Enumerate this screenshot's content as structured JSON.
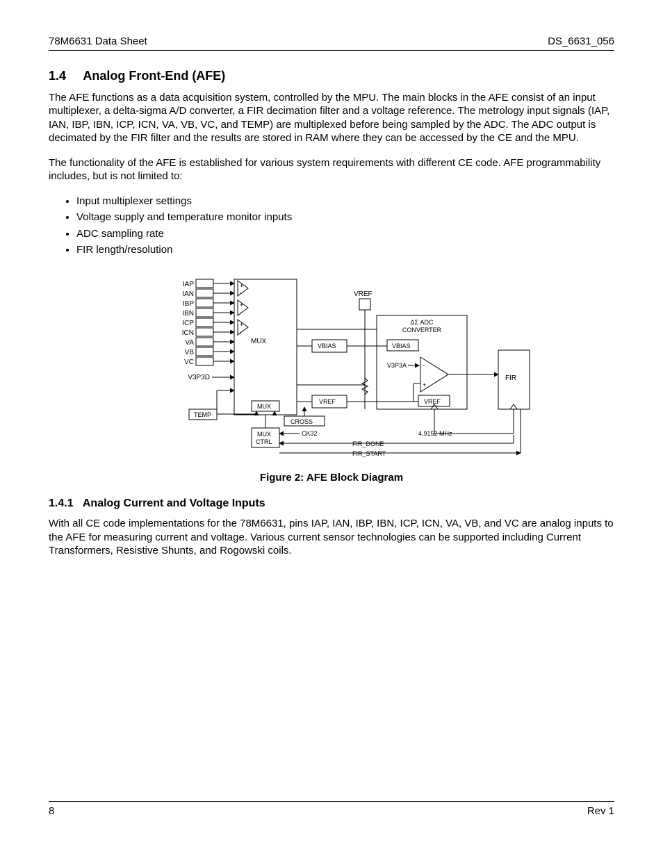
{
  "header": {
    "left": "78M6631 Data Sheet",
    "right": "DS_6631_056"
  },
  "section": {
    "num": "1.4",
    "title": "Analog Front-End (AFE)"
  },
  "para1": "The AFE functions as a data acquisition system, controlled by the MPU. The main blocks in the AFE consist of an input multiplexer, a delta-sigma A/D converter, a FIR decimation filter and a voltage reference. The metrology input signals (IAP, IAN, IBP, IBN, ICP, ICN, VA, VB, VC, and TEMP) are multiplexed before being sampled by the ADC. The ADC output is decimated by the FIR filter and the results are stored in RAM where they can be accessed by the CE and the MPU.",
  "para2": "The functionality of the AFE is established for various system requirements with different CE code. AFE programmability includes, but is not limited to:",
  "bullets": [
    "Input multiplexer settings",
    "Voltage supply and temperature monitor inputs",
    "ADC sampling rate",
    "FIR length/resolution"
  ],
  "figcaption": "Figure 2: AFE Block Diagram",
  "subsection": {
    "num": "1.4.1",
    "title": "Analog Current and Voltage Inputs"
  },
  "para3": "With all CE code implementations for the 78M6631, pins IAP, IAN, IBP, IBN, ICP, ICN, VA, VB, and VC are analog inputs to the AFE for measuring current and voltage. Various current sensor technologies can be supported including Current Transformers, Resistive Shunts, and Rogowski coils.",
  "footer": {
    "page": "8",
    "rev": "Rev 1"
  },
  "diagram": {
    "inputs": [
      "IAP",
      "IAN",
      "IBP",
      "IBN",
      "ICP",
      "ICN",
      "VA",
      "VB",
      "VC"
    ],
    "v3p3d": "V3P3D",
    "temp": "TEMP",
    "mux": "MUX",
    "mux2": "MUX",
    "muxctrl1": "MUX",
    "muxctrl2": "CTRL",
    "vbias": "VBIAS",
    "vref": "VREF",
    "adc1": "ΔΣ ADC",
    "adc2": "CONVERTER",
    "v3p3a": "V3P3A",
    "fir": "FIR",
    "cross": "CROSS",
    "ck32": "CK32",
    "mhz": "4.9152 MHz",
    "fir_done": "FIR_DONE",
    "fir_start": "FIR_START"
  }
}
